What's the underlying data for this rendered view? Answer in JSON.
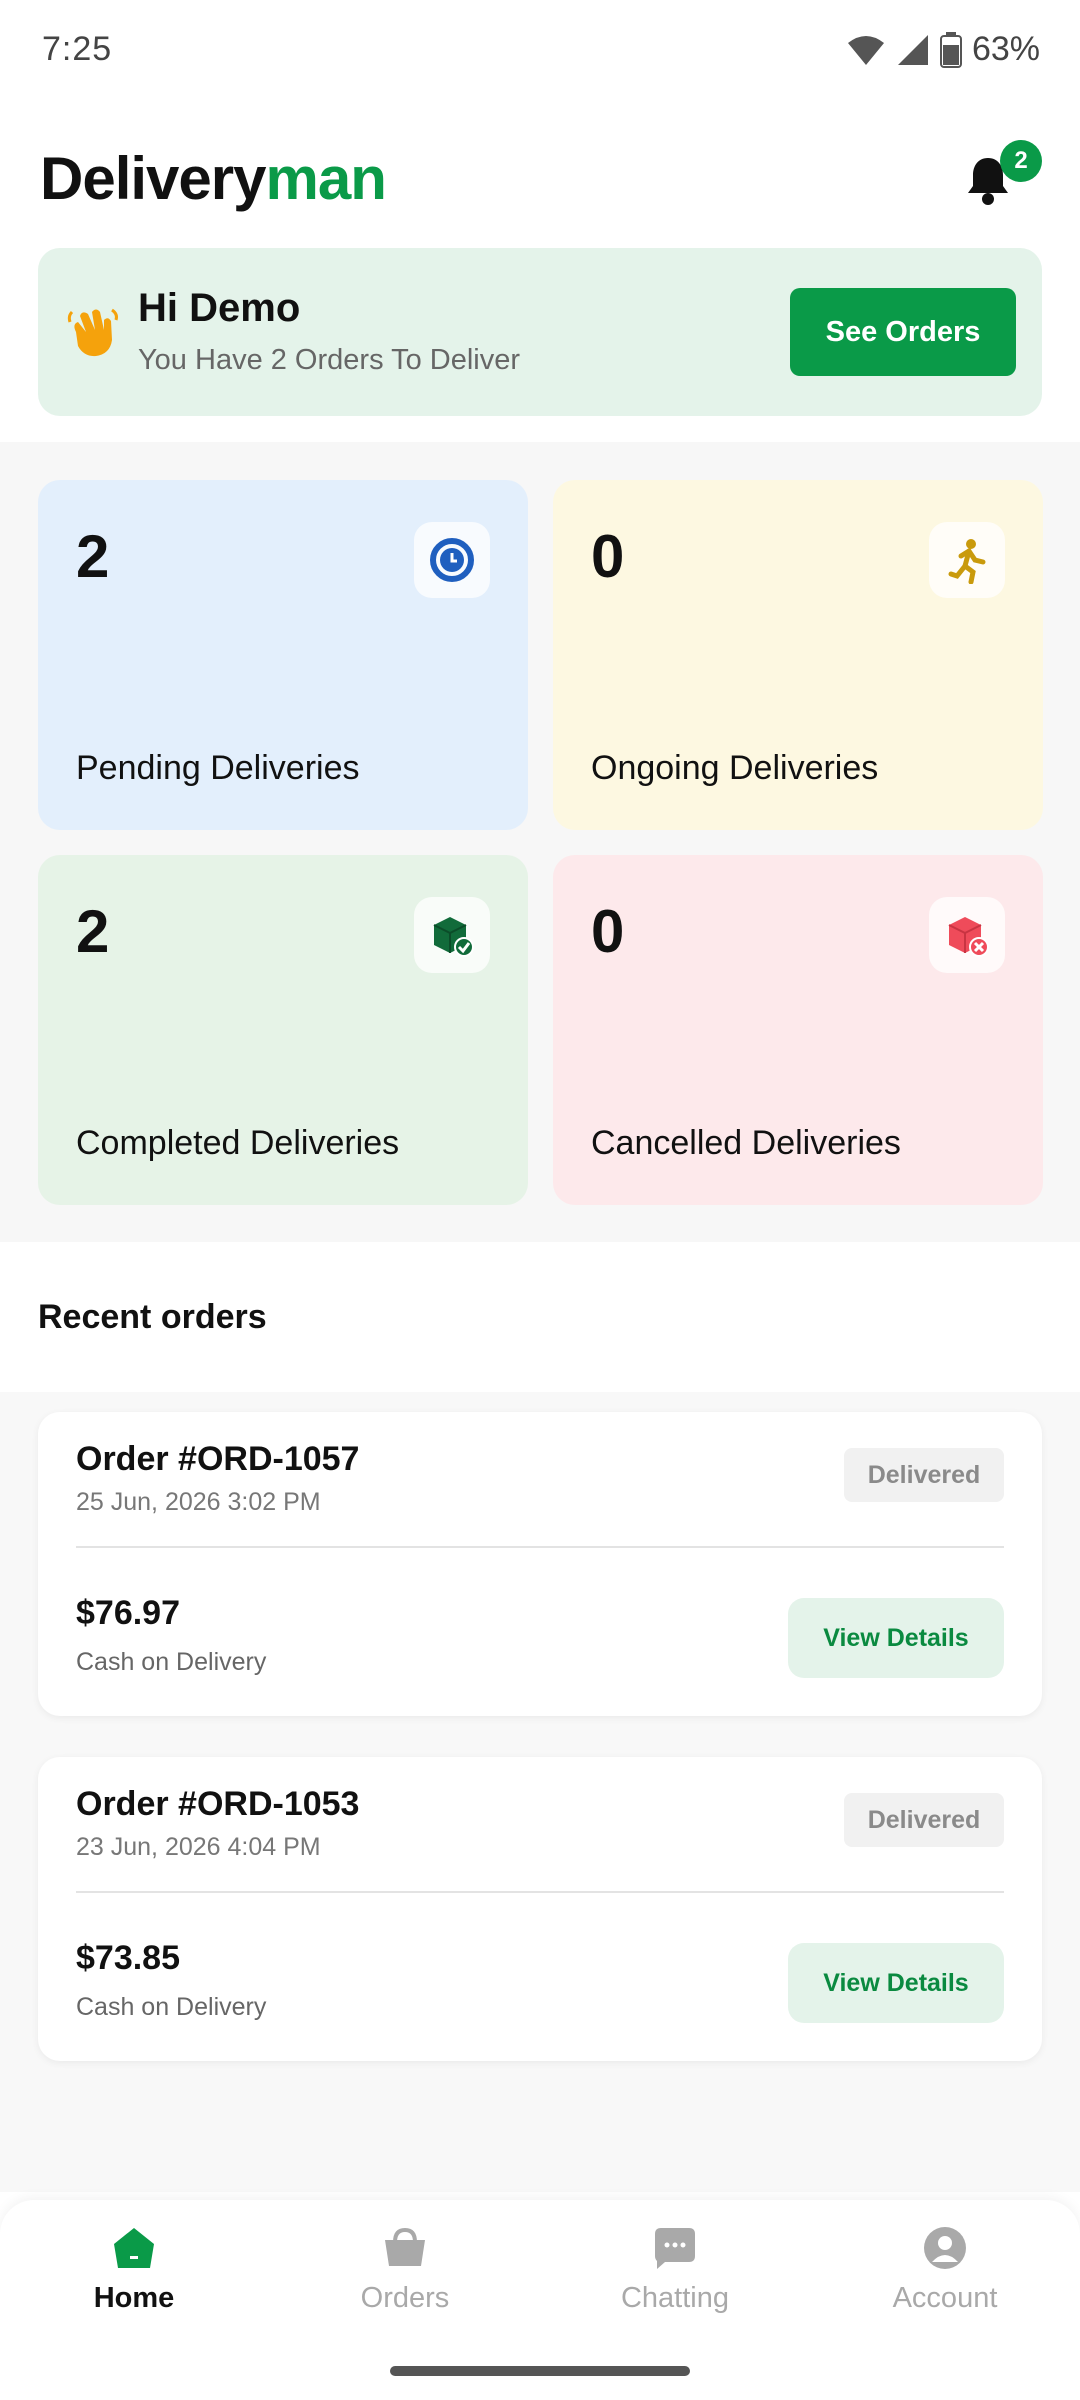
{
  "status_bar": {
    "time": "7:25",
    "battery": "63%"
  },
  "header": {
    "title_part1": "Delivery",
    "title_part2": "man",
    "notification_count": "2"
  },
  "greeting": {
    "title": "Hi Demo",
    "subtitle": "You Have 2 Orders To Deliver",
    "button_label": "See Orders"
  },
  "stats": [
    {
      "count": "2",
      "label": "Pending Deliveries",
      "icon": "clock-icon"
    },
    {
      "count": "0",
      "label": "Ongoing Deliveries",
      "icon": "running-person-icon"
    },
    {
      "count": "2",
      "label": "Completed Deliveries",
      "icon": "box-check-icon"
    },
    {
      "count": "0",
      "label": "Cancelled Deliveries",
      "icon": "box-cancel-icon"
    }
  ],
  "recent_orders": {
    "title": "Recent orders",
    "items": [
      {
        "order_id": "Order #ORD-1057",
        "date": "25 Jun, 2026 3:02 PM",
        "status": "Delivered",
        "amount": "$76.97",
        "payment": "Cash on Delivery",
        "action": "View Details"
      },
      {
        "order_id": "Order #ORD-1053",
        "date": "23 Jun, 2026 4:04 PM",
        "status": "Delivered",
        "amount": "$73.85",
        "payment": "Cash on Delivery",
        "action": "View Details"
      }
    ]
  },
  "bottom_nav": [
    {
      "label": "Home",
      "icon": "home-icon",
      "active": true
    },
    {
      "label": "Orders",
      "icon": "basket-icon",
      "active": false
    },
    {
      "label": "Chatting",
      "icon": "chat-icon",
      "active": false
    },
    {
      "label": "Account",
      "icon": "account-icon",
      "active": false
    }
  ],
  "colors": {
    "brand_green": "#0a9a48",
    "pending_bg": "#e3effc",
    "ongoing_bg": "#fdf8e1",
    "completed_bg": "#e6f3e7",
    "cancelled_bg": "#fde9eb"
  }
}
